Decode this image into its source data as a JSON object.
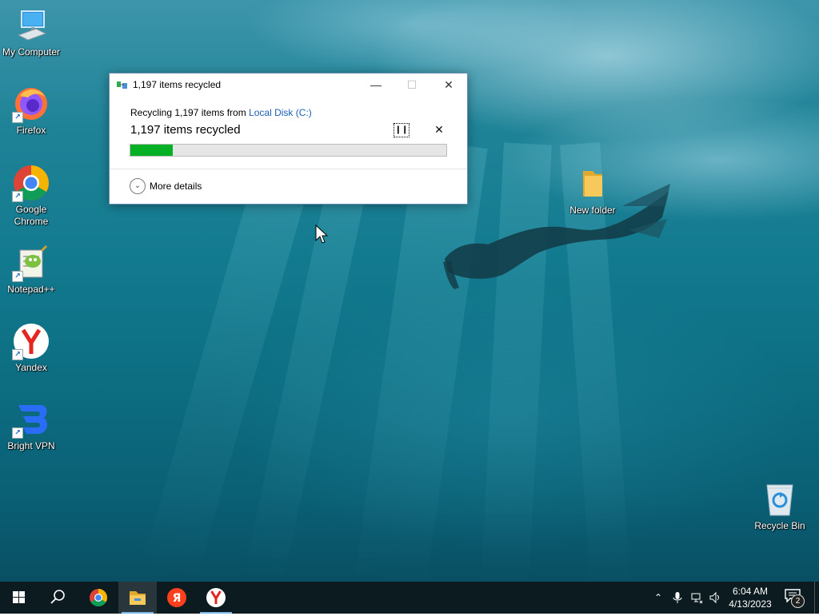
{
  "desktop": {
    "icons": [
      {
        "label": "My Computer",
        "icon": "computer-icon"
      },
      {
        "label": "Firefox",
        "icon": "firefox-icon"
      },
      {
        "label": "Google\nChrome",
        "icon": "chrome-icon"
      },
      {
        "label": "Notepad++",
        "icon": "notepadpp-icon"
      },
      {
        "label": "Yandex",
        "icon": "yandex-browser-icon"
      },
      {
        "label": "Bright VPN",
        "icon": "bright-vpn-icon"
      }
    ],
    "new_folder_label": "New folder",
    "recycle_bin_label": "Recycle Bin"
  },
  "dialog": {
    "title": "1,197 items recycled",
    "from_prefix": "Recycling 1,197 items from ",
    "from_location": "Local Disk (C:)",
    "status": "1,197 items recycled",
    "progress": 0.135,
    "pause_icon": "pause-icon",
    "stop_icon": "close-icon",
    "more_details": "More details",
    "colors": {
      "progress_fill": "#06b025",
      "link": "#1a5fb4"
    }
  },
  "taskbar": {
    "apps": [
      {
        "name": "start",
        "icon": "windows-logo-icon"
      },
      {
        "name": "search",
        "icon": "search-icon"
      },
      {
        "name": "Google Chrome",
        "icon": "chrome-icon"
      },
      {
        "name": "File Explorer",
        "icon": "file-explorer-icon",
        "active": true
      },
      {
        "name": "Yandex",
        "icon": "yandex-icon"
      },
      {
        "name": "Yandex Browser",
        "icon": "yandex-browser-icon"
      }
    ],
    "tray": {
      "icons": [
        "chevron-up-icon",
        "microphone-icon",
        "network-icon",
        "volume-icon"
      ],
      "time": "6:04 AM",
      "date": "4/13/2023",
      "notification_count": "2"
    }
  }
}
